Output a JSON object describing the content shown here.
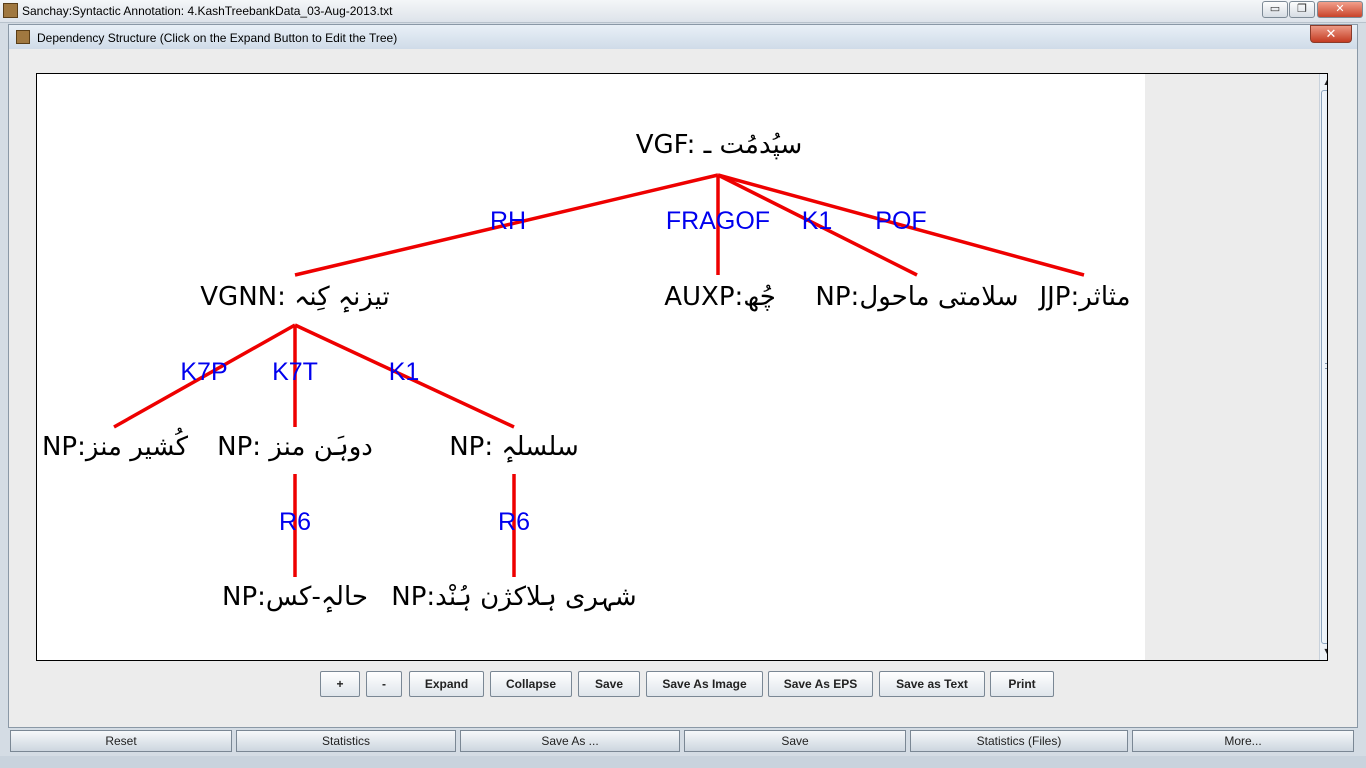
{
  "window": {
    "title": "Sanchay:Syntactic Annotation: 4.KashTreebankData_03-Aug-2013.txt",
    "min_label": "▭",
    "restore_label": "❐",
    "close_label": "✕"
  },
  "dialog": {
    "title": "Dependency Structure (Click on the Expand Button to Edit the Tree)",
    "close_label": "✕"
  },
  "tree": {
    "nodes": [
      {
        "id": "n0",
        "label": "VGF: سپُدمُت ـ"
      },
      {
        "id": "n1",
        "label": "VGNN: تیزنہٕ کِنہ"
      },
      {
        "id": "n2",
        "label": "AUXP:چُھ"
      },
      {
        "id": "n3",
        "label": "NP:سلامتی ماحول"
      },
      {
        "id": "n4",
        "label": "JJP:مثاثر"
      },
      {
        "id": "n5",
        "label": "NP:کُشیر منز"
      },
      {
        "id": "n6",
        "label": "NP: دوہَن منز"
      },
      {
        "id": "n7",
        "label": "NP: سلسلہٕ"
      },
      {
        "id": "n8",
        "label": "NP:حالہٕ-کس"
      },
      {
        "id": "n9",
        "label": "NP:شہری ہلاکژن ہُنْد"
      }
    ],
    "edges": [
      {
        "id": "e1",
        "label": "RH"
      },
      {
        "id": "e2",
        "label": "FRAGOF"
      },
      {
        "id": "e3",
        "label": "K1"
      },
      {
        "id": "e4",
        "label": "POF"
      },
      {
        "id": "e5",
        "label": "K7P"
      },
      {
        "id": "e6",
        "label": "K7T"
      },
      {
        "id": "e7",
        "label": "K1"
      },
      {
        "id": "e8",
        "label": "R6"
      },
      {
        "id": "e9",
        "label": "R6"
      }
    ],
    "edge_color": "#ee0000",
    "edge_label_color": "#0000ee"
  },
  "toolbar": {
    "plus": "+",
    "minus": "-",
    "expand": "Expand",
    "collapse": "Collapse",
    "save": "Save",
    "save_as_image": "Save As Image",
    "save_as_eps": "Save As EPS",
    "save_as_text": "Save as Text",
    "print": "Print"
  },
  "bottom": {
    "reset": "Reset",
    "statistics": "Statistics",
    "save_as": "Save As ...",
    "save": "Save",
    "statistics_files": "Statistics (Files)",
    "more": "More..."
  }
}
